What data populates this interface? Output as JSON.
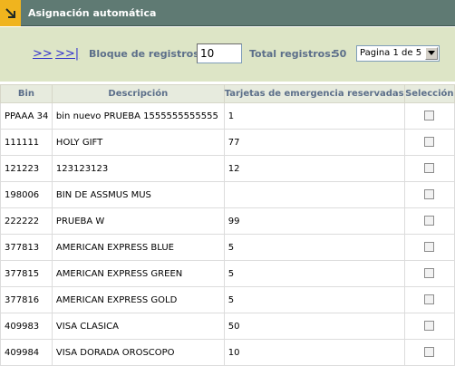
{
  "header": {
    "title": "Asignación automática",
    "icon": "arrow-corner-icon"
  },
  "toolbar": {
    "next_label": ">>",
    "last_label": ">>|",
    "bloque_label": "Bloque de registros:",
    "bloque_value": "10",
    "total_label": "Total registros:",
    "total_value": "50",
    "page_selected": "Pagina 1 de 5"
  },
  "table": {
    "headers": {
      "bin": "Bin",
      "descripcion": "Descripción",
      "tarjetas": "Tarjetas de emergencia reservadas",
      "seleccion": "Selección"
    },
    "rows": [
      {
        "bin": "PPAAA 34",
        "descripcion": "bin nuevo PRUEBA 1555555555555",
        "tarjetas": "1"
      },
      {
        "bin": "111111",
        "descripcion": "HOLY GIFT",
        "tarjetas": "77"
      },
      {
        "bin": "121223",
        "descripcion": "123123123",
        "tarjetas": "12"
      },
      {
        "bin": "198006",
        "descripcion": "BIN DE ASSMUS MUS",
        "tarjetas": ""
      },
      {
        "bin": "222222",
        "descripcion": "PRUEBA W",
        "tarjetas": "99"
      },
      {
        "bin": "377813",
        "descripcion": "AMERICAN EXPRESS BLUE",
        "tarjetas": "5"
      },
      {
        "bin": "377815",
        "descripcion": "AMERICAN EXPRESS GREEN",
        "tarjetas": "5"
      },
      {
        "bin": "377816",
        "descripcion": "AMERICAN EXPRESS GOLD",
        "tarjetas": "5"
      },
      {
        "bin": "409983",
        "descripcion": "VISA CLASICA",
        "tarjetas": "50"
      },
      {
        "bin": "409984",
        "descripcion": "VISA DORADA OROSCOPO",
        "tarjetas": "10"
      }
    ]
  },
  "colors": {
    "header_bg": "#5f7a73",
    "toolbar_bg": "#dde5c6",
    "label": "#5c6f8a",
    "link": "#3333cc",
    "accent": "#f0b41e"
  }
}
